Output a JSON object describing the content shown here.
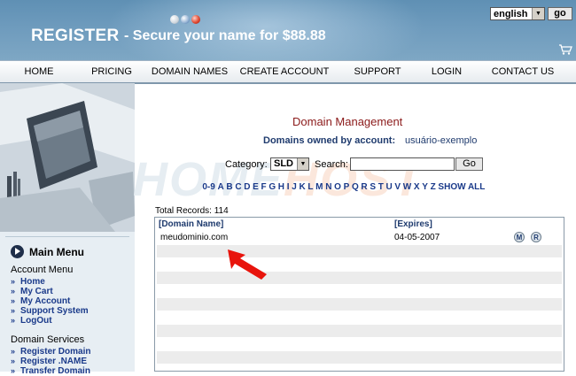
{
  "header": {
    "brand": "REGISTER",
    "tagline": "- Secure your name for $88.88",
    "language": {
      "selected": "english",
      "go_label": "go"
    },
    "icons": [
      "cart-icon"
    ]
  },
  "nav": {
    "items": [
      {
        "label": "HOME"
      },
      {
        "label": "PRICING"
      },
      {
        "label": "DOMAIN NAMES"
      },
      {
        "label": "CREATE ACCOUNT"
      },
      {
        "label": "SUPPORT"
      },
      {
        "label": "LOGIN"
      },
      {
        "label": "CONTACT US"
      }
    ]
  },
  "sidebar": {
    "main_menu": "Main Menu",
    "account_menu": {
      "title": "Account Menu",
      "items": [
        "Home",
        "My Cart",
        "My Account",
        "Support System",
        "LogOut"
      ]
    },
    "domain_services": {
      "title": "Domain Services",
      "items": [
        "Register Domain",
        "Register .NAME",
        "Transfer Domain"
      ]
    }
  },
  "watermark": {
    "part1": "HOME",
    "part2": "HOST"
  },
  "main": {
    "title": "Domain Management",
    "owned_label": "Domains owned by account:",
    "owned_user": "usuário-exemplo",
    "category_label": "Category:",
    "category_value": "SLD",
    "search_label": "Search:",
    "search_value": "",
    "search_go": "Go",
    "alpha_links": [
      "0-9",
      "A",
      "B",
      "C",
      "D",
      "E",
      "F",
      "G",
      "H",
      "I",
      "J",
      "K",
      "L",
      "M",
      "N",
      "O",
      "P",
      "Q",
      "R",
      "S",
      "T",
      "U",
      "V",
      "W",
      "X",
      "Y",
      "Z",
      "SHOW ALL"
    ],
    "total_records": "Total Records: 114",
    "table": {
      "headers": {
        "name": "[Domain Name]",
        "expires": "[Expires]"
      },
      "rows": [
        {
          "name": "meudominio.com",
          "expires": "04-05-2007",
          "actions": [
            "M",
            "R"
          ]
        }
      ]
    }
  },
  "colors": {
    "banner": "#6e9bbd",
    "title_red": "#8b1a1a",
    "link_blue": "#1a3a8a",
    "arrow_red": "#e8140c"
  }
}
